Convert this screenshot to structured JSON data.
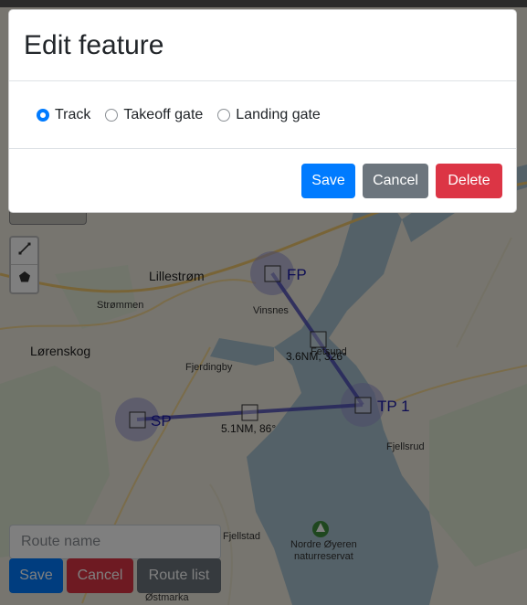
{
  "map": {
    "towns": [
      {
        "id": "lillestrom",
        "label": "Lillestrøm"
      },
      {
        "id": "strommen",
        "label": "Strømmen"
      },
      {
        "id": "lorenskog",
        "label": "Lørenskog"
      },
      {
        "id": "vinsnes",
        "label": "Vinsnes"
      },
      {
        "id": "fjerdingby",
        "label": "Fjerdingby"
      },
      {
        "id": "fetsund",
        "label": "Fetsund"
      },
      {
        "id": "fjellsrud",
        "label": "Fjellsrud"
      },
      {
        "id": "fjellstad",
        "label": "Fjellstad"
      },
      {
        "id": "nordre_oyeren",
        "label": "Nordre Øyeren"
      },
      {
        "id": "naturreservat",
        "label": "naturreservat"
      },
      {
        "id": "ostmarka",
        "label": "Østmarka"
      }
    ],
    "waypoints": [
      {
        "id": "fp",
        "label": "FP"
      },
      {
        "id": "tp1",
        "label": "TP 1"
      },
      {
        "id": "sp",
        "label": "SP"
      }
    ],
    "segments": [
      {
        "id": "seg-fp-tp1",
        "label": "3.6NM, 326°"
      },
      {
        "id": "seg-sp-tp1",
        "label": "5.1NM, 86°"
      }
    ],
    "colors": {
      "water": "#a9c3d0",
      "land": "#eeeadf",
      "route": "#4b4bb6",
      "waypoint_circle": "#9b9bd6"
    }
  },
  "toolbar": {
    "draw_line_icon": "polyline-icon",
    "draw_polygon_icon": "pentagon-icon"
  },
  "route_panel": {
    "route_name_placeholder": "Route name",
    "save_label": "Save",
    "cancel_label": "Cancel",
    "route_list_label": "Route list"
  },
  "modal": {
    "title": "Edit feature",
    "options": [
      {
        "label": "Track",
        "checked": true
      },
      {
        "label": "Takeoff gate",
        "checked": false
      },
      {
        "label": "Landing gate",
        "checked": false
      }
    ],
    "save_label": "Save",
    "cancel_label": "Cancel",
    "delete_label": "Delete"
  },
  "colors": {
    "primary": "#007bff",
    "secondary": "#6c757d",
    "danger": "#dc3545"
  }
}
